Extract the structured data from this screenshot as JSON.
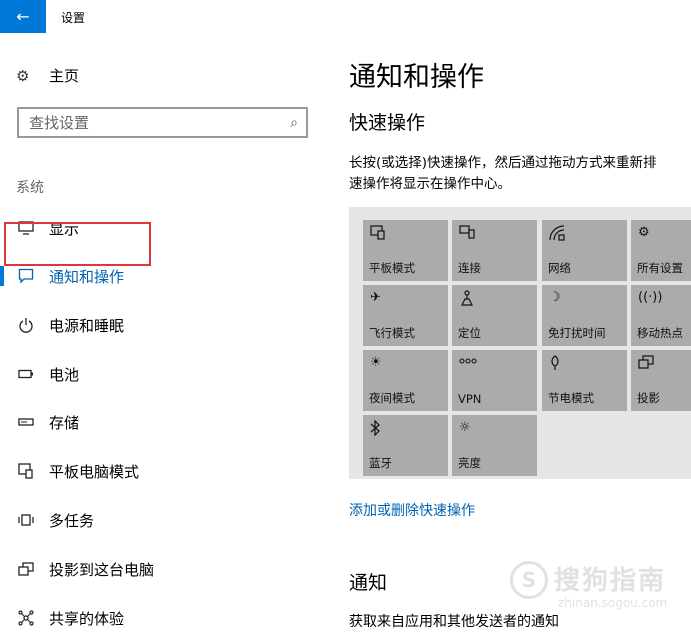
{
  "window": {
    "title": "设置",
    "back_icon": "arrow-left-icon"
  },
  "sidebar": {
    "home_label": "主页",
    "search_placeholder": "查找设置",
    "section_label": "系统",
    "items": [
      {
        "label": "显示",
        "icon": "monitor-icon"
      },
      {
        "label": "通知和操作",
        "icon": "message-icon"
      },
      {
        "label": "电源和睡眠",
        "icon": "power-icon"
      },
      {
        "label": "电池",
        "icon": "battery-icon"
      },
      {
        "label": "存储",
        "icon": "storage-icon"
      },
      {
        "label": "平板电脑模式",
        "icon": "tablet-icon"
      },
      {
        "label": "多任务",
        "icon": "multitask-icon"
      },
      {
        "label": "投影到这台电脑",
        "icon": "project-icon"
      },
      {
        "label": "共享的体验",
        "icon": "share-icon"
      }
    ],
    "active_index": 1
  },
  "main": {
    "title": "通知和操作",
    "quick_actions_title": "快速操作",
    "description_line1": "长按(或选择)快速操作，然后通过拖动方式来重新排",
    "description_line2": "速操作将显示在操作中心。",
    "tiles": [
      {
        "label": "平板模式",
        "icon": "tablet-mode-icon"
      },
      {
        "label": "连接",
        "icon": "connect-icon"
      },
      {
        "label": "网络",
        "icon": "network-icon"
      },
      {
        "label": "所有设置",
        "icon": "gear-icon"
      },
      {
        "label": "飞行模式",
        "icon": "airplane-icon"
      },
      {
        "label": "定位",
        "icon": "location-icon"
      },
      {
        "label": "免打扰时间",
        "icon": "moon-icon"
      },
      {
        "label": "移动热点",
        "icon": "hotspot-icon"
      },
      {
        "label": "夜间模式",
        "icon": "night-light-icon"
      },
      {
        "label": "VPN",
        "icon": "vpn-icon"
      },
      {
        "label": "节电模式",
        "icon": "battery-saver-icon"
      },
      {
        "label": "投影",
        "icon": "project-icon"
      },
      {
        "label": "蓝牙",
        "icon": "bluetooth-icon"
      },
      {
        "label": "亮度",
        "icon": "brightness-icon"
      }
    ],
    "add_remove_link": "添加或删除快速操作",
    "notifications_title": "通知",
    "notifications_desc": "获取来自应用和其他发送者的通知"
  },
  "watermark": {
    "text": "搜狗指南",
    "url": "zhinan.sogou.com"
  },
  "colors": {
    "accent": "#0078d7",
    "tile": "#ababab",
    "panel": "#e6e6e6",
    "highlight": "#e0353a"
  }
}
